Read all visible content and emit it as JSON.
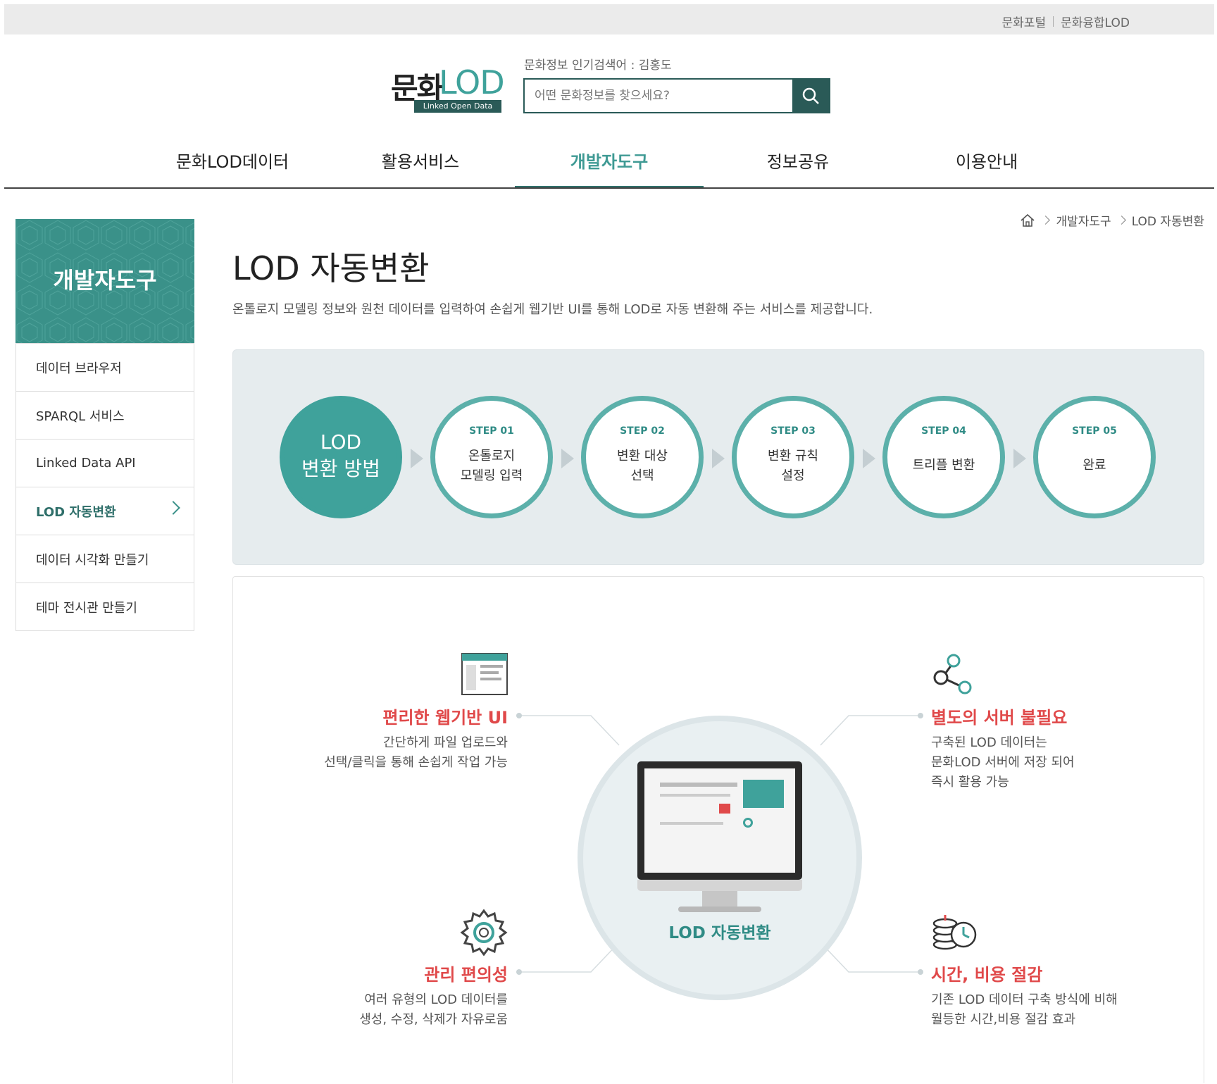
{
  "top_links": [
    "문화포털",
    "문화융합LOD"
  ],
  "logo": {
    "main_a": "문화",
    "main_b": "LOD",
    "sub": "Linked Open Data"
  },
  "search": {
    "hot_label": "문화정보 인기검색어 : 김홍도",
    "placeholder": "어떤 문화정보를 찾으세요?"
  },
  "nav": [
    "문화LOD데이터",
    "활용서비스",
    "개발자도구",
    "정보공유",
    "이용안내"
  ],
  "sidebar": {
    "title": "개발자도구",
    "items": [
      "데이터 브라우저",
      "SPARQL 서비스",
      "Linked Data API",
      "LOD 자동변환",
      "데이터 시각화 만들기",
      "테마 전시관 만들기"
    ]
  },
  "breadcrumb": [
    "개발자도구",
    "LOD 자동변환"
  ],
  "page": {
    "title": "LOD 자동변환",
    "desc": "온톨로지 모델링 정보와 원천 데이터를 입력하여 손쉽게 웹기반 UI를 통해 LOD로 자동 변환해 주는 서비스를 제공합니다."
  },
  "steps": {
    "intro_line1": "LOD",
    "intro_line2": "변환 방법",
    "items": [
      {
        "no": "STEP 01",
        "l1": "온톨로지",
        "l2": "모델링 입력"
      },
      {
        "no": "STEP 02",
        "l1": "변환 대상",
        "l2": "선택"
      },
      {
        "no": "STEP 03",
        "l1": "변환 규칙",
        "l2": "설정"
      },
      {
        "no": "STEP 04",
        "l1": "트리플 변환",
        "l2": ""
      },
      {
        "no": "STEP 05",
        "l1": "완료",
        "l2": ""
      }
    ]
  },
  "features": {
    "center_label": "LOD 자동변환",
    "tl": {
      "title": "편리한 웹기반 UI",
      "l1": "간단하게 파일 업로드와",
      "l2": "선택/클릭을 통해 손쉽게 작업 가능"
    },
    "tr": {
      "title": "별도의 서버 불필요",
      "l1": "구축된 LOD 데이터는",
      "l2": "문화LOD 서버에 저장 되어",
      "l3": "즉시 활용 가능"
    },
    "bl": {
      "title": "관리 편의성",
      "l1": "여러 유형의 LOD 데이터를",
      "l2": "생성, 수정, 삭제가 자유로움"
    },
    "br": {
      "title": "시간, 비용 절감",
      "l1": "기존 LOD 데이터 구축 방식에 비해",
      "l2": "월등한 시간,비용 절감 효과"
    }
  },
  "colors": {
    "teal": "#3fa29b",
    "dark_teal": "#2a5a57",
    "accent_red": "#e0494a"
  }
}
